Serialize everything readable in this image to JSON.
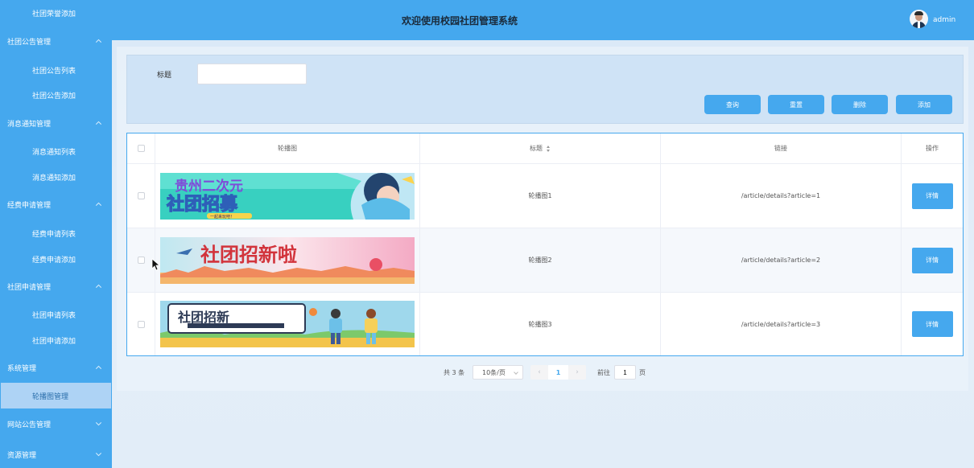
{
  "header": {
    "title": "欢迎使用校园社团管理系统",
    "username": "admin"
  },
  "sidebar": {
    "top_item": "社团荣誉添加",
    "groups": [
      {
        "label": "社团公告管理",
        "items": [
          "社团公告列表",
          "社团公告添加"
        ]
      },
      {
        "label": "消息通知管理",
        "items": [
          "消息通知列表",
          "消息通知添加"
        ]
      },
      {
        "label": "经费申请管理",
        "items": [
          "经费申请列表",
          "经费申请添加"
        ]
      },
      {
        "label": "社团申请管理",
        "items": [
          "社团申请列表",
          "社团申请添加"
        ]
      },
      {
        "label": "系统管理",
        "items": [
          "轮播图管理"
        ]
      },
      {
        "label": "网站公告管理",
        "items": []
      },
      {
        "label": "资源管理",
        "items": []
      }
    ],
    "active_item": "轮播图管理"
  },
  "search": {
    "label": "标题",
    "value": "",
    "placeholder": ""
  },
  "buttons": {
    "query": "查询",
    "reset": "重置",
    "delete": "删除",
    "add": "添加"
  },
  "table": {
    "columns": [
      "轮播图",
      "标题",
      "链接",
      "操作"
    ],
    "rows": [
      {
        "title": "轮播图1",
        "link": "/article/details?article=1",
        "action": "详情",
        "banner_text": "贵州二次元",
        "banner_sub": "社团招募",
        "banner_tag": "一起来玩吧！"
      },
      {
        "title": "轮播图2",
        "link": "/article/details?article=2",
        "action": "详情",
        "banner_text": "社团招新啦"
      },
      {
        "title": "轮播图3",
        "link": "/article/details?article=3",
        "action": "详情",
        "banner_text": "社团招新"
      }
    ]
  },
  "pagination": {
    "total": "共 3 条",
    "page_size": "10条/页",
    "current": "1",
    "goto_label": "前往",
    "goto_value": "1",
    "page_suffix": "页"
  },
  "colors": {
    "primary": "#45a8ee",
    "sidebar_bg": "#45a8ee",
    "active_item_bg": "#aed3f5"
  }
}
